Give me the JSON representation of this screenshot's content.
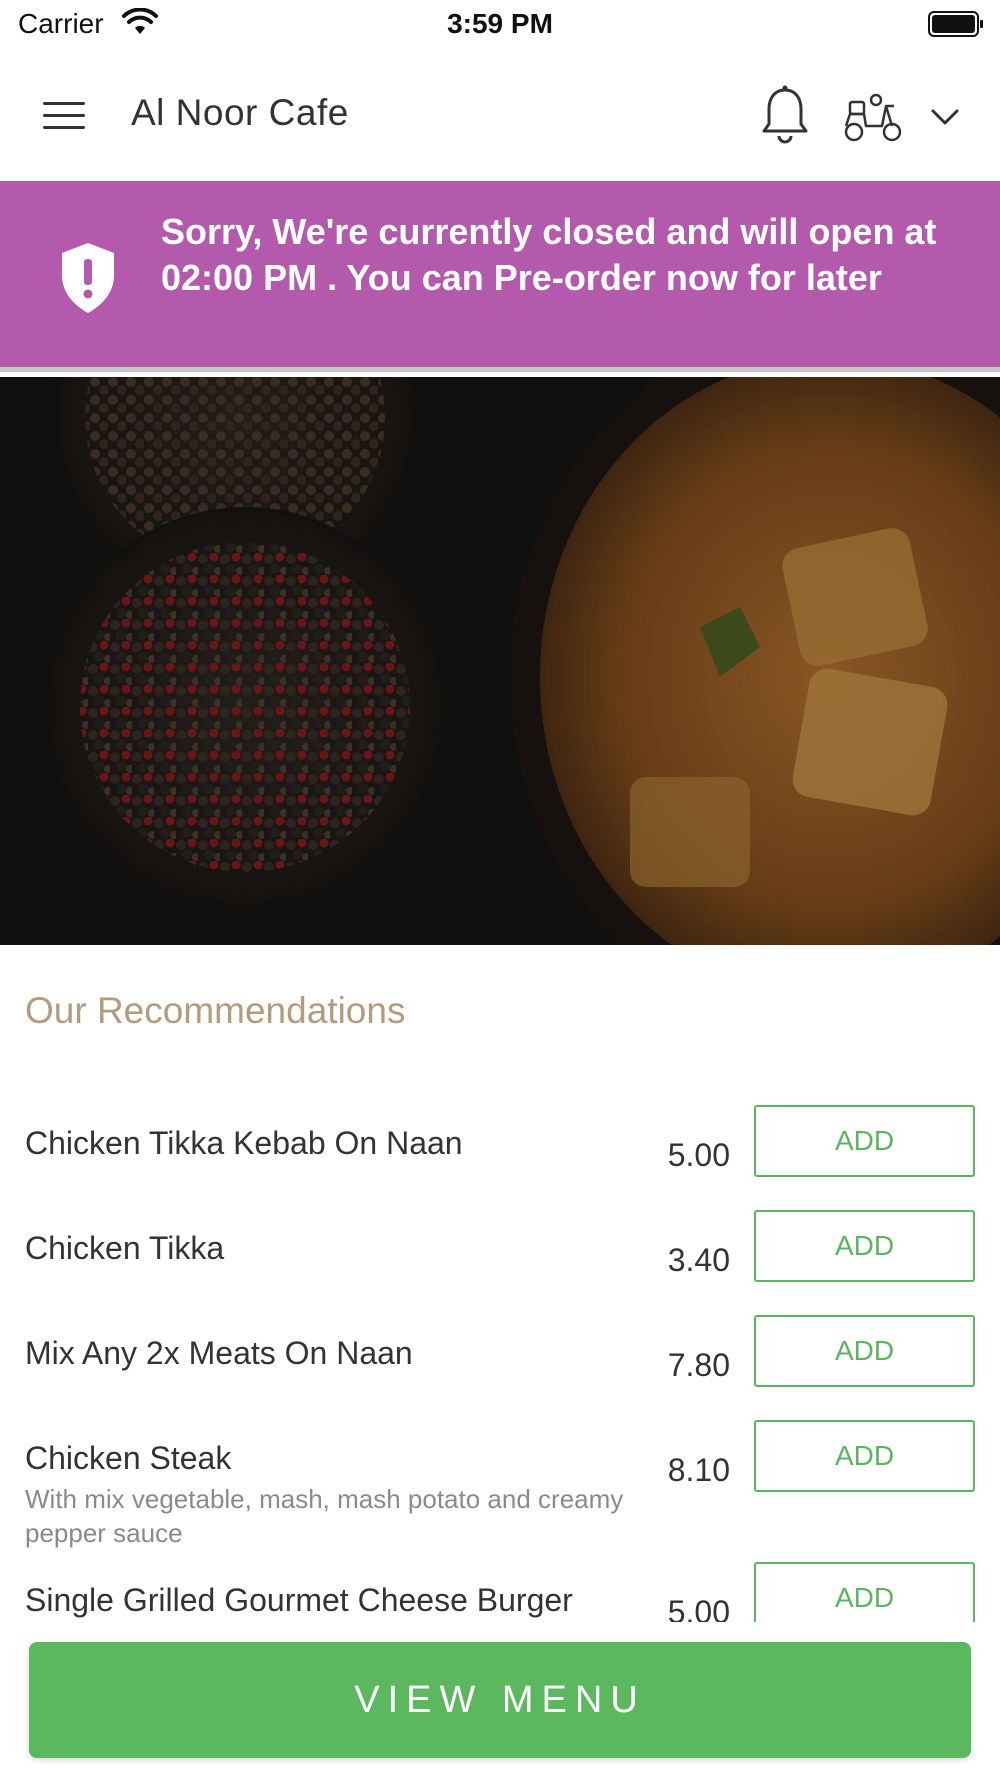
{
  "status_bar": {
    "carrier": "Carrier",
    "time": "3:59 PM"
  },
  "header": {
    "title": "Al Noor Cafe",
    "icons": [
      "menu-icon",
      "bell-icon",
      "scooter-icon",
      "chevron-down-icon"
    ]
  },
  "banner": {
    "message": "Sorry, We're currently closed and will open at 02:00 PM . You can Pre-order now for later",
    "color": "#b35aad",
    "icon": "shield-alert-icon"
  },
  "recommendations": {
    "title": "Our Recommendations",
    "add_label": "ADD",
    "items": [
      {
        "name": "Chicken Tikka Kebab On Naan",
        "description": "",
        "price": "5.00"
      },
      {
        "name": "Chicken Tikka",
        "description": "",
        "price": "3.40"
      },
      {
        "name": "Mix Any 2x Meats On Naan",
        "description": "",
        "price": "7.80"
      },
      {
        "name": "Chicken Steak",
        "description": "With mix vegetable, mash, mash potato and creamy pepper sauce",
        "price": "8.10"
      },
      {
        "name": "Single Grilled Gourmet Cheese Burger",
        "description": "",
        "price": "5.00"
      }
    ]
  },
  "footer": {
    "view_menu_label": "VIEW MENU",
    "color": "#5cb85f"
  },
  "colors": {
    "accent_title": "#b39c7d",
    "add_button": "#5bb45f"
  }
}
